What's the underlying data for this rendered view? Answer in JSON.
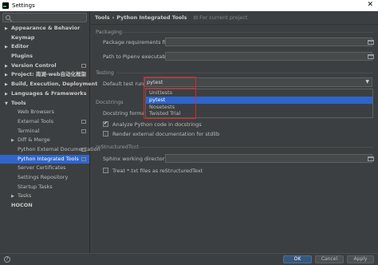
{
  "window": {
    "title": "Settings"
  },
  "sidebar": {
    "items": [
      {
        "label": "Appearance & Behavior",
        "kind": "parent-collapsed"
      },
      {
        "label": "Keymap",
        "kind": "top"
      },
      {
        "label": "Editor",
        "kind": "parent-collapsed"
      },
      {
        "label": "Plugins",
        "kind": "top"
      },
      {
        "label": "Version Control",
        "kind": "parent-collapsed"
      },
      {
        "label": "Project: 南湖-web自动化框架",
        "kind": "parent-collapsed"
      },
      {
        "label": "Build, Execution, Deployment",
        "kind": "parent-collapsed"
      },
      {
        "label": "Languages & Frameworks",
        "kind": "parent-collapsed"
      },
      {
        "label": "Tools",
        "kind": "parent-expanded"
      },
      {
        "label": "Web Browsers",
        "kind": "child"
      },
      {
        "label": "External Tools",
        "kind": "child"
      },
      {
        "label": "Terminal",
        "kind": "child"
      },
      {
        "label": "Diff & Merge",
        "kind": "child-collapsed"
      },
      {
        "label": "Python External Documentation",
        "kind": "child"
      },
      {
        "label": "Python Integrated Tools",
        "kind": "child",
        "selected": true
      },
      {
        "label": "Server Certificates",
        "kind": "child"
      },
      {
        "label": "Settings Repository",
        "kind": "child"
      },
      {
        "label": "Startup Tasks",
        "kind": "child"
      },
      {
        "label": "Tasks",
        "kind": "child-collapsed"
      },
      {
        "label": "HOCON",
        "kind": "top"
      }
    ]
  },
  "breadcrumb": {
    "root": "Tools",
    "separator": "›",
    "current": "Python Integrated Tools",
    "scope": "For current project"
  },
  "packaging": {
    "section_title": "Packaging",
    "requirements_label": "Package requirements file:",
    "requirements_value": "",
    "pipenv_label": "Path to Pipenv executable:",
    "pipenv_value": ""
  },
  "testing": {
    "section_title": "Testing",
    "runner_label": "Default test runner:",
    "runner_value": "pytest",
    "options": [
      "Unittests",
      "pytest",
      "Nosetests",
      "Twisted Trial"
    ],
    "selected_index": 1
  },
  "docstrings": {
    "section_title": "Docstrings",
    "format_label": "Docstring format:",
    "analyze_label": "Analyze Python code in docstrings",
    "analyze_checked": true,
    "render_label": "Render external documentation for stdlib",
    "render_checked": false
  },
  "restructured": {
    "section_title": "reStructuredText",
    "sphinx_label": "Sphinx working directory:",
    "sphinx_value": "",
    "treat_label": "Treat *.txt files as reStructuredText",
    "treat_checked": false
  },
  "footer": {
    "help": "?",
    "ok": "OK",
    "cancel": "Cancel",
    "apply": "Apply"
  },
  "colors": {
    "accent": "#2f65ca",
    "highlight": "#e02424",
    "background": "#3c3f41"
  }
}
